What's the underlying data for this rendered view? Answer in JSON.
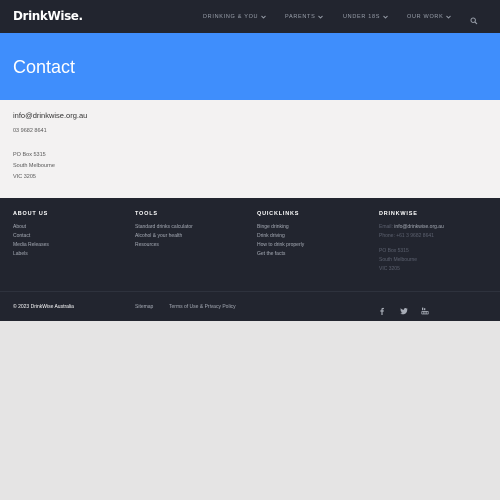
{
  "header": {
    "logo": "DrinkWise.",
    "nav": [
      {
        "label": "DRINKING & YOU"
      },
      {
        "label": "PARENTS"
      },
      {
        "label": "UNDER 18s"
      },
      {
        "label": "OUR WORK"
      }
    ],
    "search_icon": "search-icon"
  },
  "hero": {
    "title": "Contact"
  },
  "contact": {
    "email": "info@drinkwise.org.au",
    "phone": "03 9682 8641",
    "address": [
      "PO Box 5315",
      "South Melbourne",
      "VIC 3205"
    ]
  },
  "footer": {
    "about": {
      "heading": "ABOUT US",
      "links": [
        "About",
        "Contact",
        "Media Releases",
        "Labels"
      ]
    },
    "tools": {
      "heading": "TOOLS",
      "links": [
        "Standard drinks calculator",
        "Alcohol & your health",
        "Resources"
      ]
    },
    "quicklinks": {
      "heading": "QUICKLINKS",
      "links": [
        "Binge drinking",
        "Drink driving",
        "How to drink properly",
        "Get the facts"
      ]
    },
    "drinkwise": {
      "heading": "DRINKWISE",
      "email_label": "Email:",
      "email": "info@drinkwise.org.au",
      "phone": "Phone: +61 3 9682 8641",
      "address": [
        "PO Box 5315",
        "South Melbourne",
        "VIC 3205"
      ]
    },
    "copyright": "© 2023 DrinkWise Australia",
    "sitemap": "Sitemap",
    "terms": "Terms of Use & Privacy Policy",
    "social_icons": [
      "facebook-icon",
      "twitter-icon",
      "youtube-icon"
    ]
  },
  "colors": {
    "topbar": "#22252f",
    "hero": "#3f8efc",
    "contact_bg": "#f3f2f2",
    "page_bg": "#e5e4e4"
  }
}
